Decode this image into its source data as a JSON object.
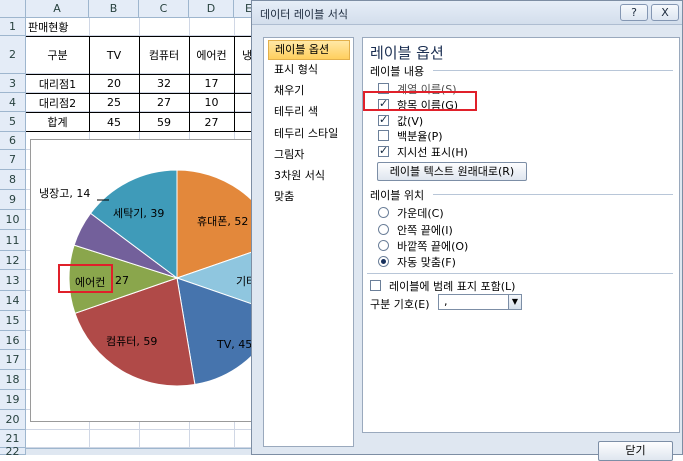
{
  "sheet": {
    "columns": [
      "A",
      "B",
      "C",
      "D",
      "E"
    ],
    "rows": [
      "1",
      "2",
      "3",
      "4",
      "5",
      "6",
      "7",
      "8",
      "9",
      "10",
      "11",
      "12",
      "13",
      "14",
      "15",
      "16",
      "17",
      "18",
      "19",
      "20",
      "21",
      "22"
    ],
    "title_cell": "판매현황",
    "table": {
      "headers": [
        "구분",
        "TV",
        "컴퓨터",
        "에어컨",
        "냉"
      ],
      "rows": [
        [
          "대리점1",
          "20",
          "32",
          "17",
          ""
        ],
        [
          "대리점2",
          "25",
          "27",
          "10",
          ""
        ],
        [
          "합계",
          "45",
          "59",
          "27",
          ""
        ]
      ]
    }
  },
  "chart": {
    "labels": {
      "fridge": "냉장고, 14",
      "washer": "세탁기, 39",
      "phone": "휴대폰, 52",
      "other": "기타",
      "tv": "TV, 45",
      "computer": "컴퓨터, 59",
      "aircon_name": "에어컨",
      "aircon_value": "27"
    }
  },
  "chart_data": {
    "type": "pie",
    "categories": [
      "휴대폰",
      "기타",
      "TV",
      "컴퓨터",
      "에어컨",
      "냉장고",
      "세탁기"
    ],
    "values": [
      52,
      28,
      45,
      59,
      27,
      14,
      39
    ],
    "colors": [
      "#e3883b",
      "#8fc6df",
      "#4674ad",
      "#b04a48",
      "#8aa64c",
      "#73609b",
      "#3f9bb9"
    ]
  },
  "dialog": {
    "title": "데이터 레이블 서식",
    "help_button": "?",
    "close_x": "X",
    "nav": [
      "레이블 옵션",
      "표시 형식",
      "채우기",
      "테두리 색",
      "테두리 스타일",
      "그림자",
      "3차원 서식",
      "맞춤"
    ],
    "panel": {
      "heading": "레이블 옵션",
      "contents_section": "레이블 내용",
      "checkboxes": [
        {
          "label": "계열 이름(S)",
          "checked": false
        },
        {
          "label": "항목 이름(G)",
          "checked": true
        },
        {
          "label": "값(V)",
          "checked": true
        },
        {
          "label": "백분율(P)",
          "checked": false
        },
        {
          "label": "지시선 표시(H)",
          "checked": true
        }
      ],
      "reset_button": "레이블 텍스트 원래대로(R)",
      "position_section": "레이블 위치",
      "radios": [
        {
          "label": "가운데(C)",
          "selected": false
        },
        {
          "label": "안쪽 끝에(I)",
          "selected": false
        },
        {
          "label": "바깥쪽 끝에(O)",
          "selected": false
        },
        {
          "label": "자동 맞춤(F)",
          "selected": true
        }
      ],
      "legend_key_checkbox": "레이블에 범례 표지 포함(L)",
      "separator_label": "구분 기호(E)",
      "separator_value": ","
    },
    "close_button": "닫기"
  }
}
